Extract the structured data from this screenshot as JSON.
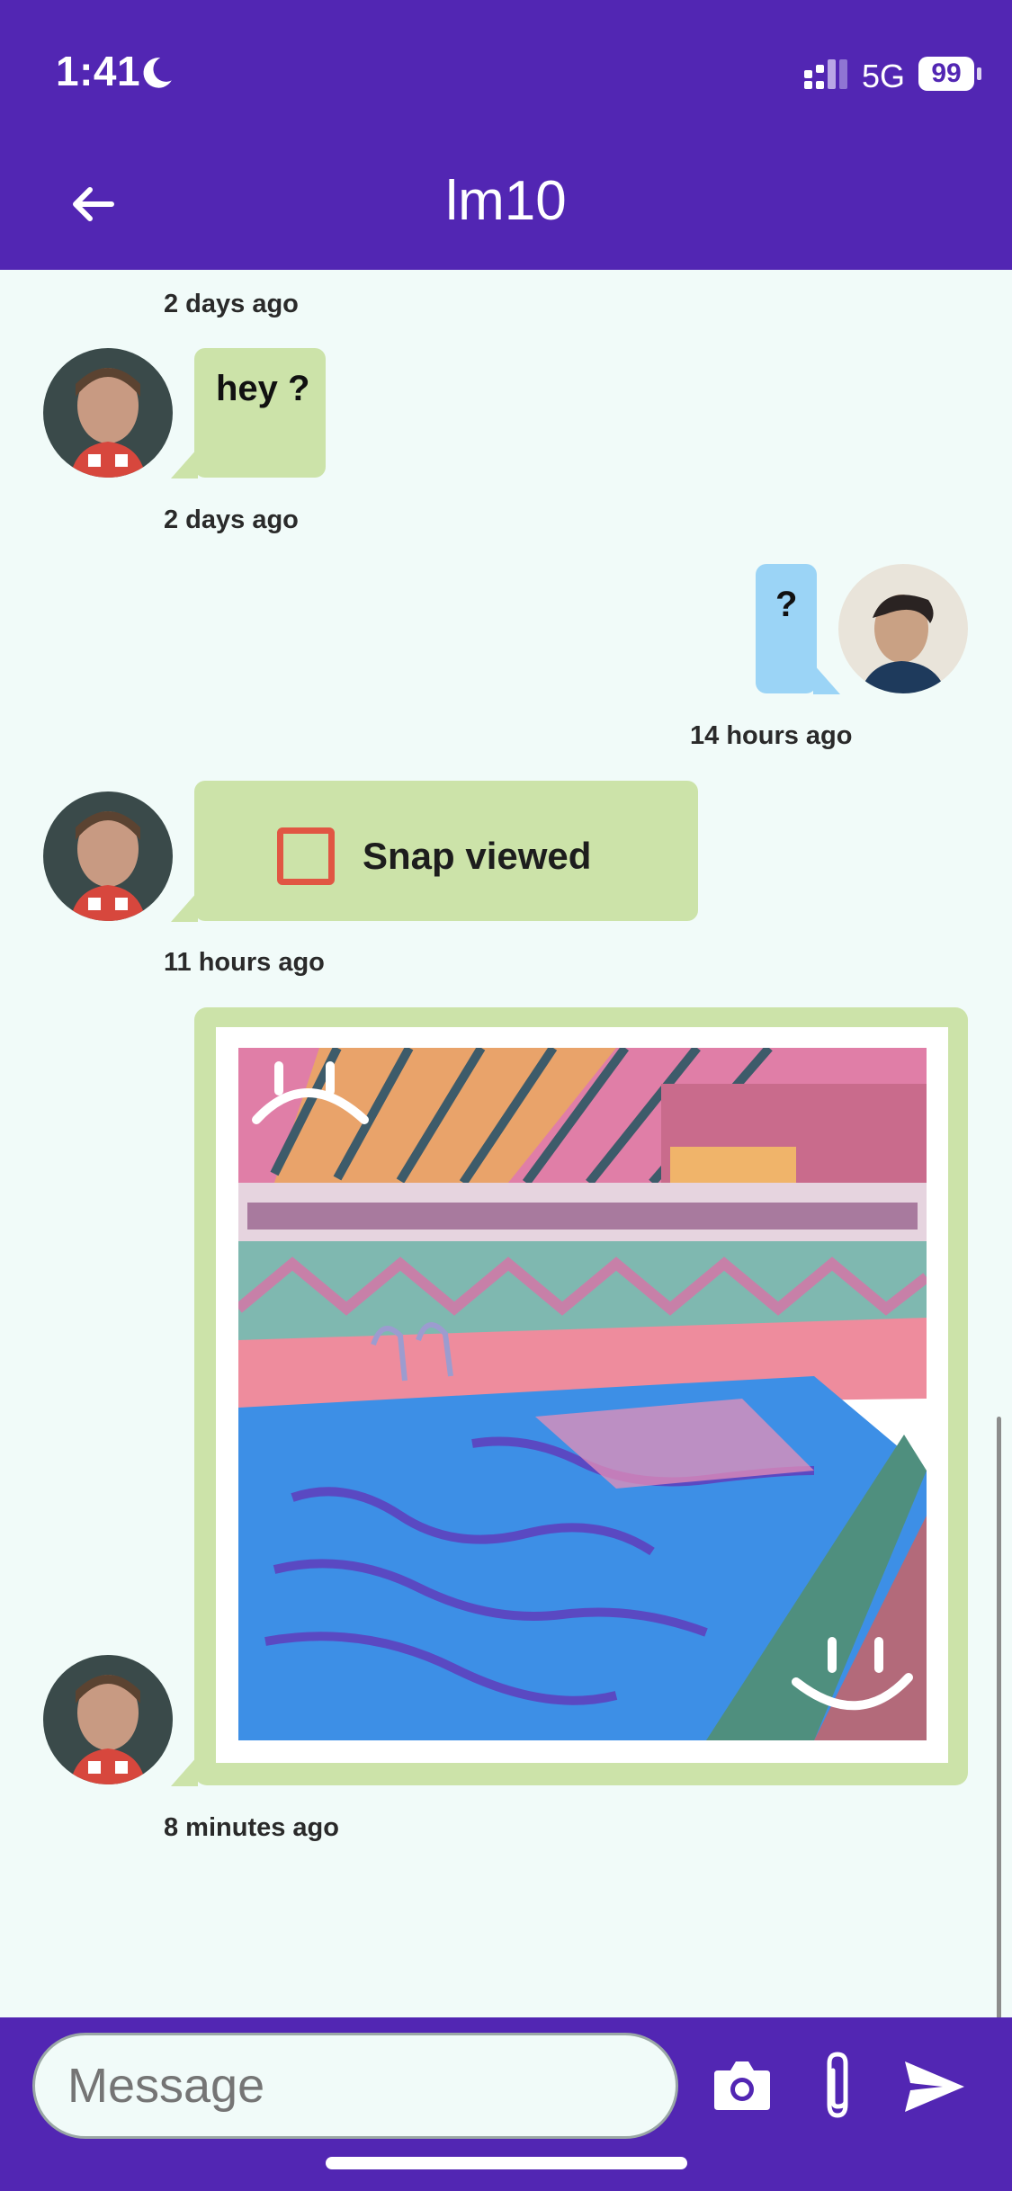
{
  "status_bar": {
    "time": "1:41",
    "network": "5G",
    "battery": "99"
  },
  "header": {
    "title": "lm10"
  },
  "messages": [
    {
      "direction": "in",
      "text": "hey ?",
      "timestamp_above": "2 days ago",
      "timestamp_below": "2 days ago"
    },
    {
      "direction": "out",
      "text": "?",
      "timestamp_below": "14 hours ago"
    },
    {
      "direction": "in",
      "type": "snap",
      "text": "Snap viewed",
      "timestamp_below": "11 hours ago"
    },
    {
      "direction": "in",
      "type": "image",
      "timestamp_below": "8 minutes ago"
    }
  ],
  "composer": {
    "placeholder": "Message"
  },
  "icons": [
    "moon-icon",
    "signal-icon",
    "back-arrow-icon",
    "camera-icon",
    "paperclip-icon",
    "send-icon"
  ],
  "colors": {
    "primary": "#5226b3",
    "incoming_bubble": "#cce3a9",
    "outgoing_bubble": "#9bd4f6",
    "background": "#f1fbf9",
    "snap_red": "#e15643"
  }
}
